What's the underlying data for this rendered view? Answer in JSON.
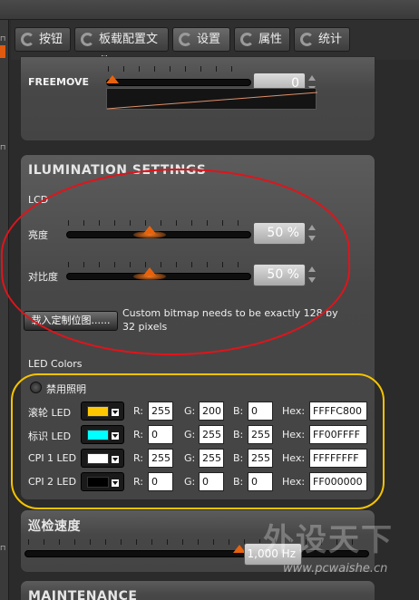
{
  "tabs": [
    {
      "label": "按钮",
      "icon": "refresh-icon"
    },
    {
      "label": "板载配置文件",
      "icon": "refresh-icon"
    },
    {
      "label": "设置",
      "icon": "refresh-icon",
      "active": true
    },
    {
      "label": "属性",
      "icon": "refresh-icon"
    },
    {
      "label": "统计",
      "icon": "refresh-icon"
    }
  ],
  "freemove": {
    "label": "FREEMOVE",
    "value": "0",
    "level": 0
  },
  "illumination": {
    "title": "ILUMINATION SETTINGS",
    "lcd_label": "LCD",
    "brightness": {
      "label": "亮度",
      "value": "50 %",
      "level": 0.5
    },
    "contrast": {
      "label": "对比度",
      "value": "50 %",
      "level": 0.5
    },
    "load_bitmap_button": "载入定制位图......",
    "bitmap_note": "Custom bitmap needs to be exactly 128 by 32 pixels",
    "led_colors_label": "LED Colors",
    "disable_lighting": "禁用照明",
    "channel_labels": {
      "r": "R:",
      "g": "G:",
      "b": "B:",
      "hex": "Hex:"
    },
    "leds": [
      {
        "name": "滚轮 LED",
        "color": "#FFC800",
        "r": "255",
        "g": "200",
        "b": "0",
        "hex": "FFFFC800"
      },
      {
        "name": "标识 LED",
        "color": "#00FFFF",
        "r": "0",
        "g": "255",
        "b": "255",
        "hex": "FF00FFFF"
      },
      {
        "name": "CPI 1 LED",
        "color": "#FFFFFF",
        "r": "255",
        "g": "255",
        "b": "255",
        "hex": "FFFFFFFF"
      },
      {
        "name": "CPI 2 LED",
        "color": "#000000",
        "r": "0",
        "g": "0",
        "b": "0",
        "hex": "FF000000"
      }
    ]
  },
  "patrol": {
    "title": "巡检速度",
    "value": "1,000 Hz",
    "level": 0.83
  },
  "maintenance": {
    "title": "MAINTENANCE"
  },
  "watermark": {
    "text": "外设天下",
    "url": "www.pcwaishe.cn"
  },
  "colors": {
    "accent": "#E8620E",
    "annotation_red": "#E0141B",
    "annotation_yellow": "#F5C400"
  }
}
